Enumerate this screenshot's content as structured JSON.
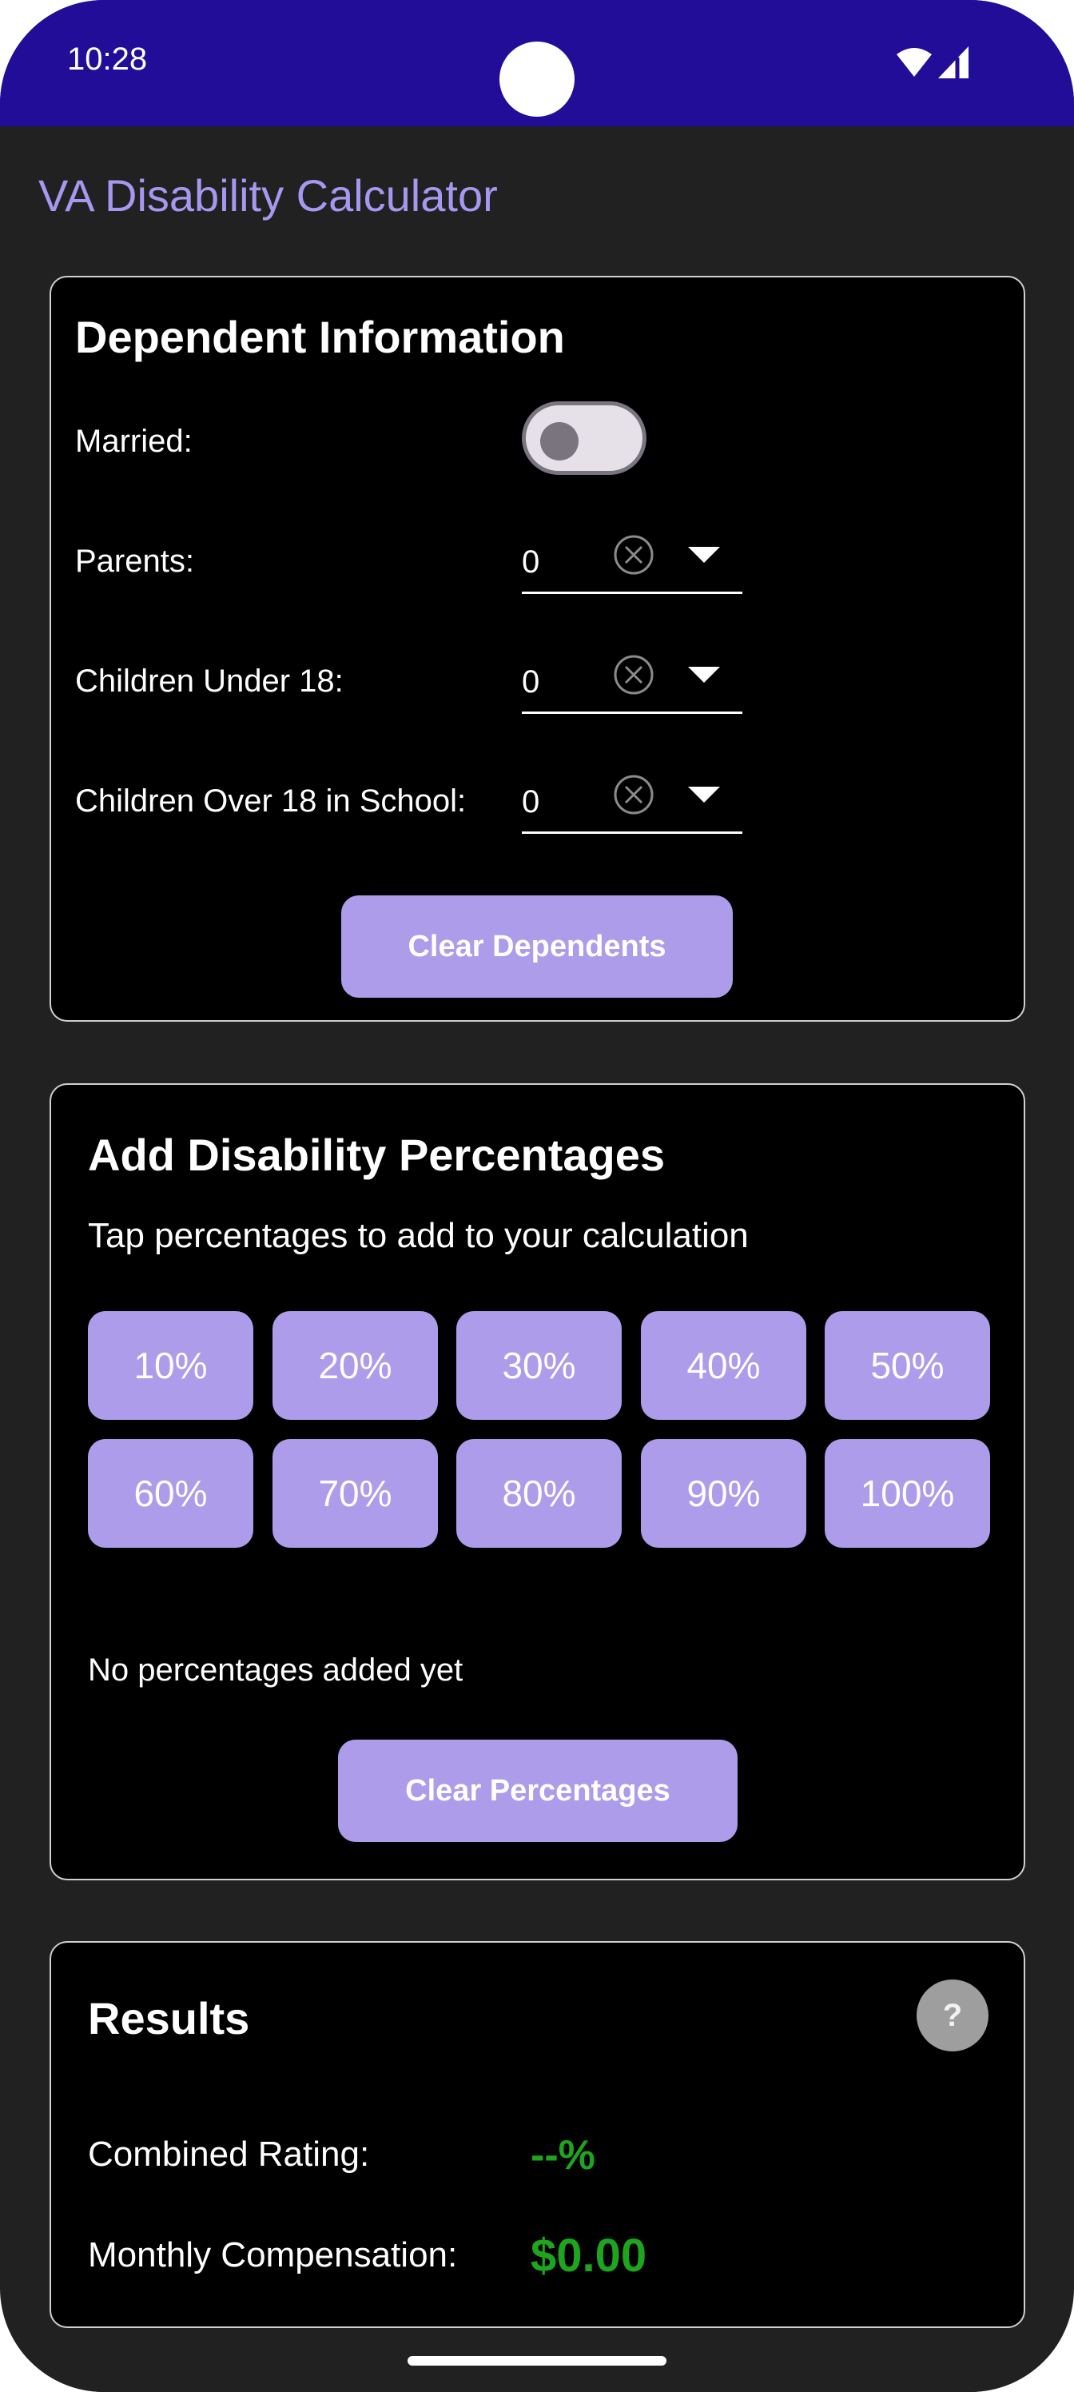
{
  "status_bar": {
    "time": "10:28",
    "icons": [
      "wifi-icon",
      "signal-icon"
    ]
  },
  "app": {
    "title": "VA Disability Calculator"
  },
  "dependents": {
    "heading": "Dependent Information",
    "married_label": "Married:",
    "married_on": false,
    "fields": [
      {
        "label": "Parents:",
        "value": "0"
      },
      {
        "label": "Children Under 18:",
        "value": "0"
      },
      {
        "label": "Children Over 18 in School:",
        "value": "0"
      }
    ],
    "clear_button": "Clear Dependents"
  },
  "percentages": {
    "heading": "Add Disability Percentages",
    "subtitle": "Tap percentages to add to your calculation",
    "buttons": [
      "10%",
      "20%",
      "30%",
      "40%",
      "50%",
      "60%",
      "70%",
      "80%",
      "90%",
      "100%"
    ],
    "empty_text": "No percentages added yet",
    "clear_button": "Clear Percentages"
  },
  "results": {
    "heading": "Results",
    "help_label": "?",
    "combined_label": "Combined Rating:",
    "combined_value": "--%",
    "monthly_label": "Monthly Compensation:",
    "monthly_value": "$0.00"
  },
  "colors": {
    "status_bar": "#220d99",
    "accent": "#ac9ce9",
    "title": "#a797f0",
    "result_value": "#1ea51e",
    "background": "#212121",
    "card": "#000000"
  }
}
